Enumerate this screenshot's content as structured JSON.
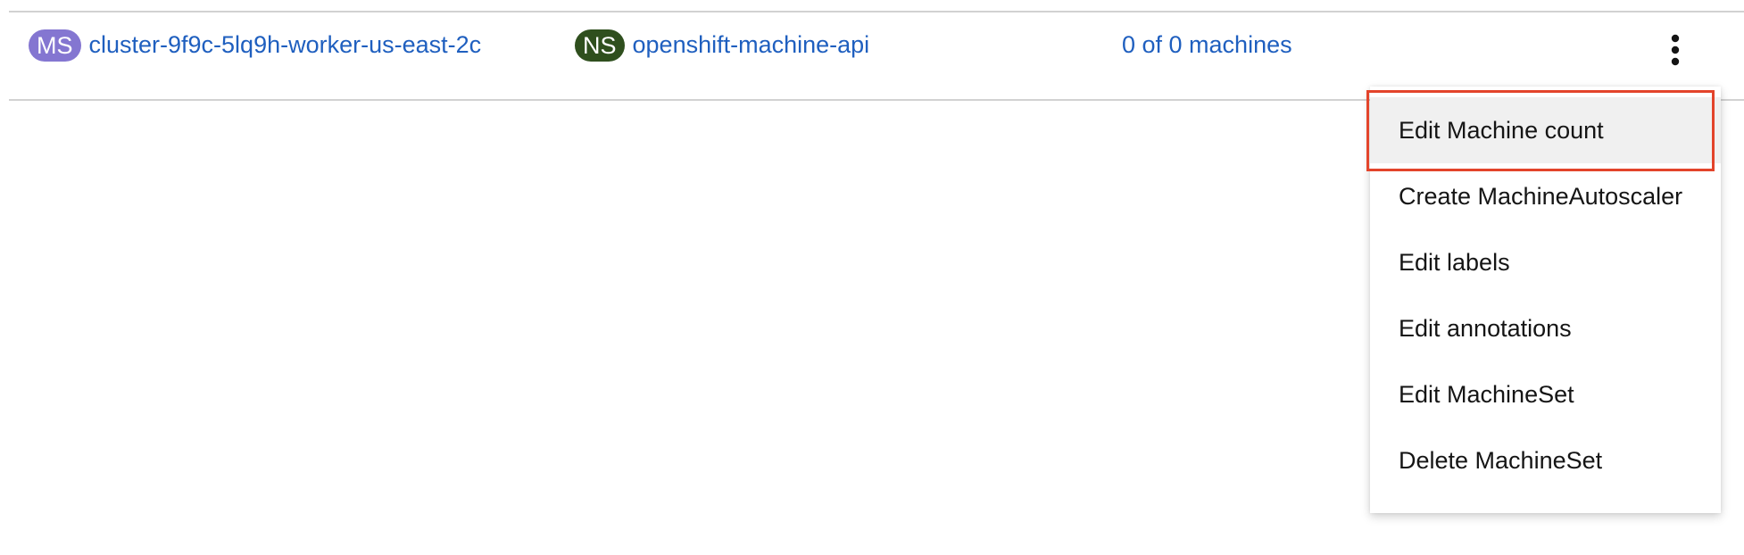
{
  "row": {
    "machineset": {
      "badge": "MS",
      "name": "cluster-9f9c-5lq9h-worker-us-east-2c"
    },
    "namespace": {
      "badge": "NS",
      "name": "openshift-machine-api"
    },
    "machines": "0 of 0 machines",
    "kebab_icon": "kebab-vertical-icon"
  },
  "menu": {
    "items": [
      {
        "label": "Edit Machine count",
        "highlighted": true
      },
      {
        "label": "Create MachineAutoscaler"
      },
      {
        "label": "Edit labels"
      },
      {
        "label": "Edit annotations"
      },
      {
        "label": "Edit MachineSet"
      },
      {
        "label": "Delete MachineSet"
      }
    ]
  },
  "colors": {
    "link": "#1f5fbf",
    "badge_ms": "#8476d1",
    "badge_ns": "#2f4f1e",
    "highlight": "#e3442b",
    "menu_active_bg": "#f0f0f0"
  }
}
